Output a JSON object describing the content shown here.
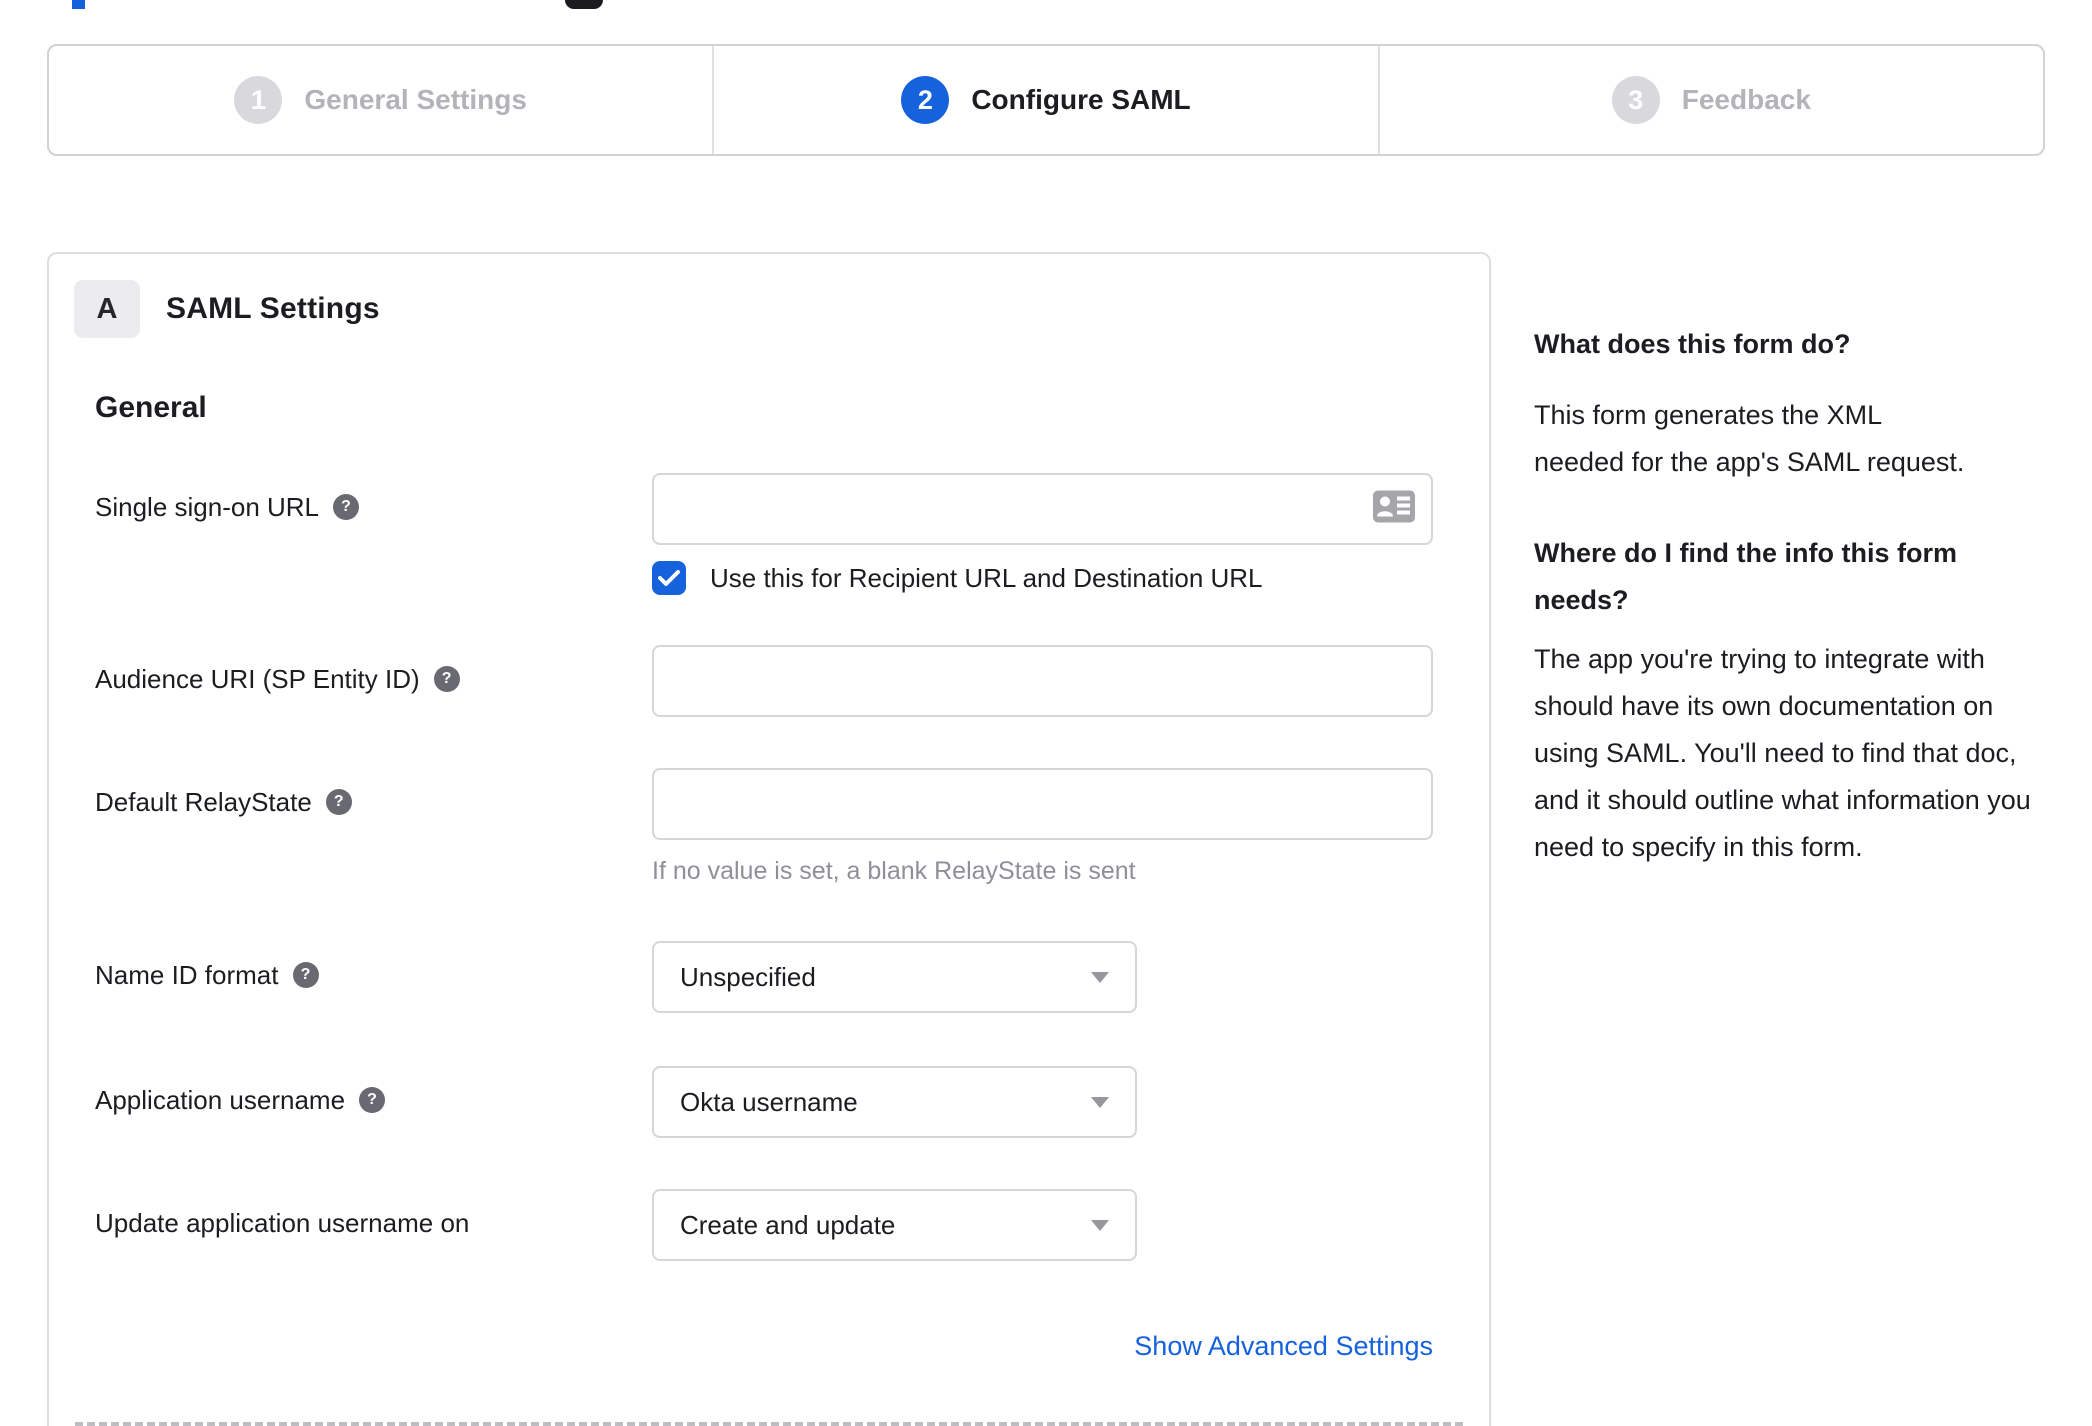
{
  "colors": {
    "accent": "#1662dd"
  },
  "stepper": {
    "steps": [
      {
        "number": "1",
        "label": "General Settings",
        "state": "inactive"
      },
      {
        "number": "2",
        "label": "Configure SAML",
        "state": "active"
      },
      {
        "number": "3",
        "label": "Feedback",
        "state": "inactive"
      }
    ]
  },
  "panel": {
    "badge": "A",
    "title": "SAML Settings",
    "section": "General",
    "fields": {
      "sso": {
        "label": "Single sign-on URL",
        "value": "",
        "checkbox_label": "Use this for Recipient URL and Destination URL",
        "checkbox_checked": true
      },
      "audience": {
        "label": "Audience URI (SP Entity ID)",
        "value": ""
      },
      "relay": {
        "label": "Default RelayState",
        "value": "",
        "hint": "If no value is set, a blank RelayState is sent"
      },
      "name_id": {
        "label": "Name ID format",
        "value": "Unspecified"
      },
      "app_username": {
        "label": "Application username",
        "value": "Okta username"
      },
      "update_username": {
        "label": "Update application username on",
        "value": "Create and update"
      }
    },
    "advanced_link": "Show Advanced Settings"
  },
  "sidebar": {
    "q1": "What does this form do?",
    "a1": "This form generates the XML needed for the app's SAML request.",
    "q2": "Where do I find the info this form needs?",
    "a2": "The app you're trying to integrate with should have its own documentation on using SAML. You'll need to find that doc, and it should outline what information you need to specify in this form."
  }
}
